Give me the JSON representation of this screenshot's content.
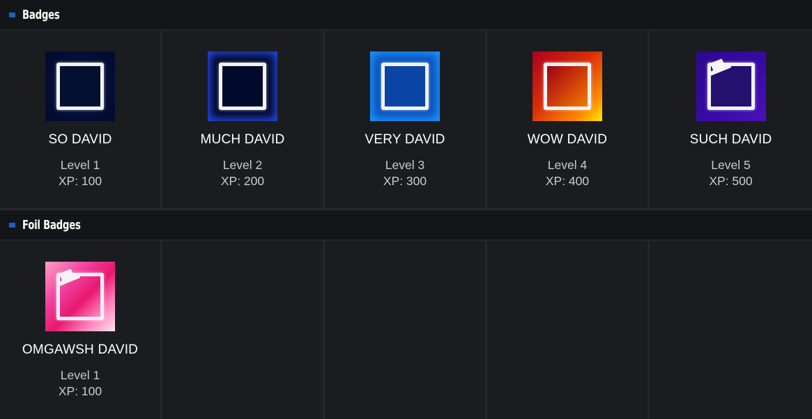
{
  "sections": {
    "badges": {
      "title": "Badges",
      "items": [
        {
          "name": "SO DAVID",
          "level": "Level 1",
          "xp": "XP: 100"
        },
        {
          "name": "MUCH DAVID",
          "level": "Level 2",
          "xp": "XP: 200"
        },
        {
          "name": "VERY DAVID",
          "level": "Level 3",
          "xp": "XP: 300"
        },
        {
          "name": "WOW DAVID",
          "level": "Level 4",
          "xp": "XP: 400"
        },
        {
          "name": "SUCH DAVID",
          "level": "Level 5",
          "xp": "XP: 500"
        }
      ]
    },
    "foil": {
      "title": "Foil Badges",
      "items": [
        {
          "name": "OMGAWSH DAVID",
          "level": "Level 1",
          "xp": "XP: 100"
        }
      ]
    }
  },
  "colors": {
    "accent": "#1e5fbf",
    "background": "#1b1c20",
    "header": "#141518"
  }
}
